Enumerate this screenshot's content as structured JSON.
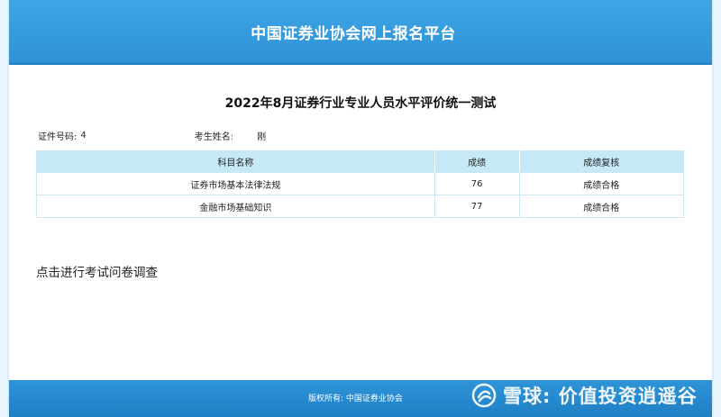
{
  "header": {
    "title": "中国证券业协会网上报名平台"
  },
  "exam": {
    "title": "2022年8月证券行业专业人员水平评价统一测试"
  },
  "candidate": {
    "id_label": "证件号码:",
    "id_value": "4",
    "name_label": "考生姓名:",
    "name_value": "刚"
  },
  "scores_table": {
    "headers": [
      "科目名称",
      "成绩",
      "成绩复核"
    ],
    "rows": [
      {
        "subject": "证券市场基本法律法规",
        "score": "76",
        "review": "成绩合格"
      },
      {
        "subject": "金融市场基础知识",
        "score": "77",
        "review": "成绩合格"
      }
    ]
  },
  "survey": {
    "link_text": "点击进行考试问卷调查"
  },
  "footer": {
    "copyright": "版权所有: 中国证券业协会"
  },
  "watermark": {
    "text": "雪球: 价值投资逍遥谷"
  },
  "colors": {
    "header_blue": "#2f92d6",
    "table_header_bg": "#c7e8f7",
    "page_bg": "#eaf6fd"
  }
}
